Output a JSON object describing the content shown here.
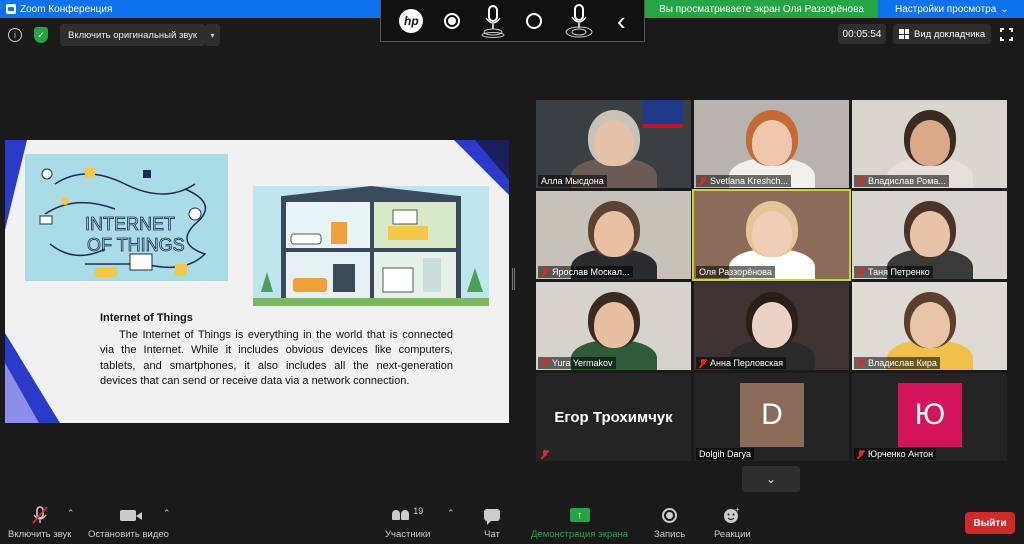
{
  "window": {
    "title": "Zoom Конференция"
  },
  "share_banner": {
    "viewing": "Вы просматриваете экран Оля Раззорёнова",
    "settings": "Настройки просмотра",
    "settings_caret": "⌄"
  },
  "hp_toolbar": {
    "logo": "hp",
    "mic_icon": "microphone-icon",
    "mic_alt_icon": "microphone-icon",
    "back": "‹"
  },
  "top_row": {
    "info": "i",
    "shield": "✓",
    "original_sound": "Включить оригинальный звук",
    "original_sound_caret": "▾",
    "timer": "00:05:54",
    "speaker_view": "Вид докладчика"
  },
  "slide": {
    "heading": "Internet of Things",
    "body": "The Internet of Things  is everything in the world that is connected via the Internet. While it includes obvious devices like computers, tablets, and smartphones, it also includes all the next-generation devices that can send or receive data via a network connection.",
    "iot_title_line1": "INTERNET",
    "iot_title_line2": "OF THINGS"
  },
  "participants": [
    {
      "name": "Алла Мысдона",
      "muted": false
    },
    {
      "name": "Svetlana Kreshch...",
      "muted": true
    },
    {
      "name": "Владислав Рома...",
      "muted": true
    },
    {
      "name": "Ярослав Москал...",
      "muted": true
    },
    {
      "name": "Оля Раззорёнова",
      "muted": false,
      "active": true
    },
    {
      "name": "Таня Петренко",
      "muted": true
    },
    {
      "name": "Yura Yermakov",
      "muted": true
    },
    {
      "name": "Анна Перловская",
      "muted": true
    },
    {
      "name": "Владислав Кира",
      "muted": true
    },
    {
      "name": "Егор Трохимчук",
      "muted": true,
      "video_off": true
    },
    {
      "name": "Dolgih Darya",
      "muted": false,
      "avatar_letter": "D",
      "avatar_color": "#8a6a58"
    },
    {
      "name": "Юрченко Антон",
      "muted": true,
      "avatar_letter": "Ю",
      "avatar_color": "#d4145a"
    }
  ],
  "pager": {
    "down": "⌄"
  },
  "toolbar": {
    "unmute": "Включить звук",
    "stop_video": "Остановить видео",
    "participants": "Участники",
    "participants_count": "19",
    "chat": "Чат",
    "share_screen": "Демонстрация экрана",
    "record": "Запись",
    "reactions": "Реакции",
    "leave": "Выйти",
    "caret": "⌃",
    "share_arrow": "↑"
  },
  "colors": {
    "accent_blue": "#0e72ed",
    "share_green": "#26a544",
    "leave_red": "#cd2a2a",
    "active_outline": "#c8d81e"
  }
}
